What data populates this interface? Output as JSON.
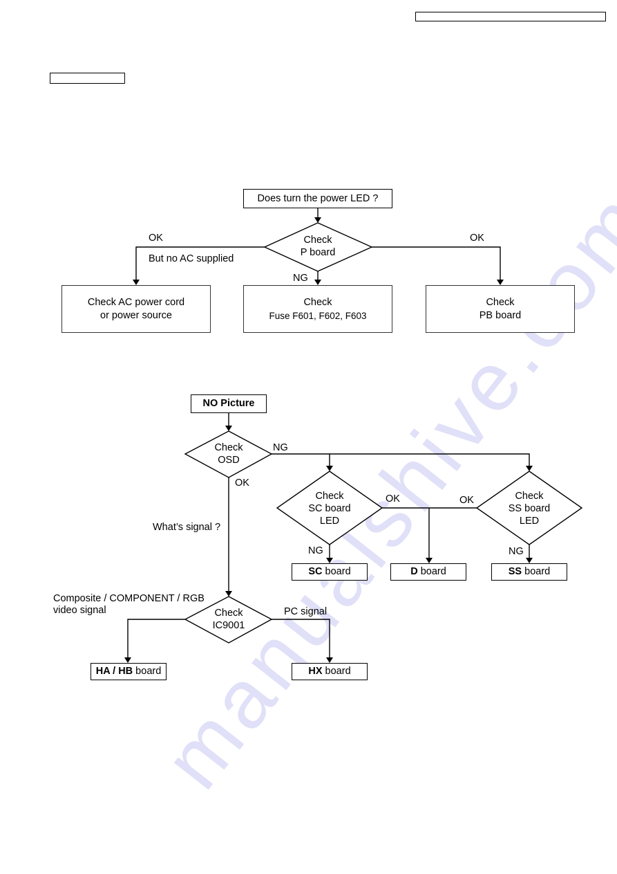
{
  "header": {
    "top_right_field": "",
    "section_tag": ""
  },
  "watermark": "manualshive.com",
  "flow1": {
    "start": "Does turn the power LED ?",
    "decision": [
      "Check",
      "P board"
    ],
    "left_label_ok": "OK",
    "left_label_note": "But no AC supplied",
    "down_label": "NG",
    "right_label": "OK",
    "result_left": [
      "Check AC power cord",
      "or power source"
    ],
    "result_center": [
      "Check",
      "Fuse  F601, F602, F603"
    ],
    "result_right": [
      "Check",
      "PB board"
    ]
  },
  "flow2": {
    "start": "NO Picture",
    "osd_decision": [
      "Check",
      "OSD"
    ],
    "osd_ng": "NG",
    "osd_ok": "OK",
    "signal_question": "What’s signal ?",
    "sc_decision": [
      "Check",
      "SC board",
      "LED"
    ],
    "ss_decision": [
      "Check",
      "SS board",
      "LED"
    ],
    "sc_ok": "OK",
    "ss_ok": "OK",
    "sc_ng": "NG",
    "ss_ng": "NG",
    "sc_result": {
      "bold": "SC",
      "rest": " board"
    },
    "d_result": {
      "bold": "D",
      "rest": " board"
    },
    "ss_result": {
      "bold": "SS",
      "rest": " board"
    },
    "ic_decision": [
      "Check",
      "IC9001"
    ],
    "video_label": [
      "Composite / COMPONENT / RGB",
      "video signal"
    ],
    "pc_label": "PC signal",
    "ha_result": {
      "bold": "HA / HB",
      "rest": " board"
    },
    "hx_result": {
      "bold": "HX",
      "rest": " board"
    }
  }
}
